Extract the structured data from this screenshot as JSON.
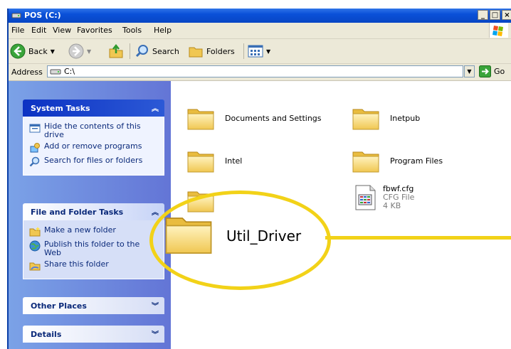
{
  "window": {
    "title": "POS (C:)"
  },
  "menu": [
    "File",
    "Edit",
    "View",
    "Favorites",
    "Tools",
    "Help"
  ],
  "toolbar": {
    "back": "Back",
    "search": "Search",
    "folders": "Folders"
  },
  "address": {
    "label": "Address",
    "value": "C:\\",
    "go": "Go"
  },
  "taskpane": {
    "system_tasks": {
      "title": "System Tasks",
      "items": [
        "Hide the contents of this drive",
        "Add or remove programs",
        "Search for files or folders"
      ]
    },
    "file_folder_tasks": {
      "title": "File and Folder Tasks",
      "items": [
        "Make a new folder",
        "Publish this folder to the Web",
        "Share this folder"
      ]
    },
    "other_places": {
      "title": "Other Places"
    },
    "details": {
      "title": "Details"
    }
  },
  "files": {
    "folders": [
      "Documents and Settings",
      "Inetpub",
      "Intel",
      "Program Files"
    ],
    "cfg_file": {
      "name": "fbwf.cfg",
      "type": "CFG File",
      "size": "4 KB"
    }
  },
  "callout": {
    "label": "Util_Driver",
    "color": "#f2d218"
  },
  "colors": {
    "titlebar": "#0a50d8",
    "taskpane": "#7ba2e7",
    "folder": "#f5d86a"
  }
}
